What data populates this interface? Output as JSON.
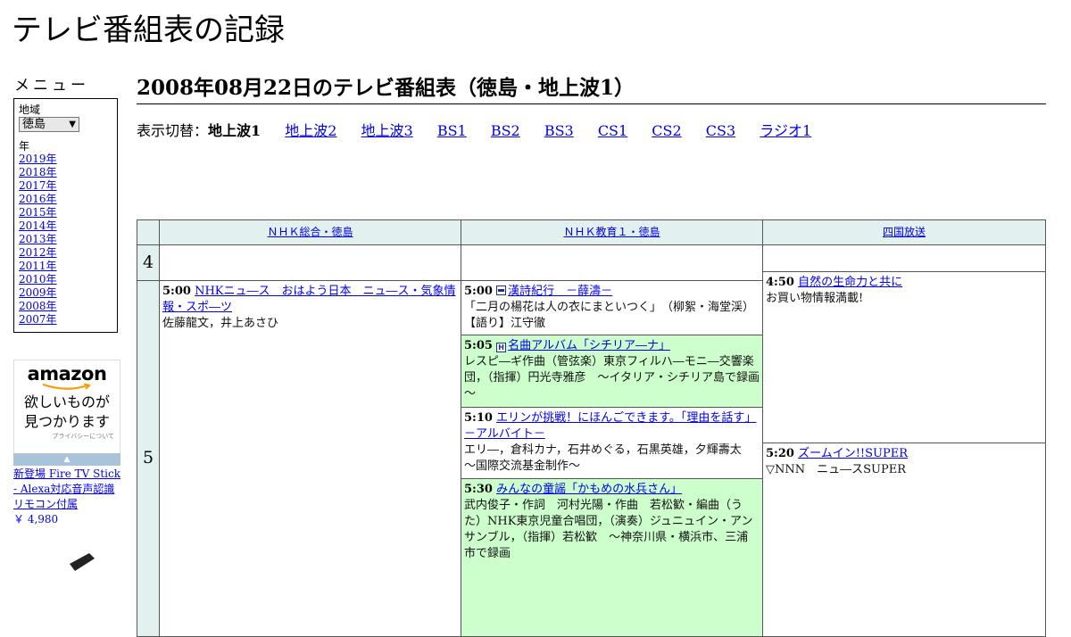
{
  "site_title": "テレビ番組表の記録",
  "sidebar": {
    "menu_heading": "メニュー",
    "region_label": "地域",
    "region_value": "徳島",
    "year_label": "年",
    "years": [
      "2019年",
      "2018年",
      "2017年",
      "2016年",
      "2015年",
      "2014年",
      "2013年",
      "2012年",
      "2011年",
      "2010年",
      "2009年",
      "2008年",
      "2007年"
    ]
  },
  "ad": {
    "logo": "amazon",
    "copy_line1": "欲しいものが",
    "copy_line2": "見つかります",
    "privacy": "プライバシーについて",
    "product": "新登場 Fire TV Stick - Alexa対応音声認識リモコン付属",
    "price": "￥ 4,980"
  },
  "page_title": "2008年08月22日のテレビ番組表（徳島・地上波1）",
  "switcher": {
    "label": "表示切替：",
    "current": "地上波1",
    "links": [
      "地上波2",
      "地上波3",
      "BS1",
      "BS2",
      "BS3",
      "CS1",
      "CS2",
      "CS3",
      "ラジオ1"
    ]
  },
  "channels": [
    "ＮＨＫ総合・徳島",
    "ＮＨＫ教育１・徳島",
    "四国放送"
  ],
  "hours": [
    "4",
    "5"
  ],
  "programs": {
    "nhk_g": [
      {
        "time": "5:00",
        "title": "NHKニュ―ス　おはよう日本　ニュ―ス・気象情報・スポ―ツ",
        "desc": "佐藤龍文，井上あさひ"
      }
    ],
    "nhk_e": [
      {
        "time": "5:00",
        "badge": "字",
        "title": "漢詩紀行　－薛濤－",
        "desc": "「二月の楊花は人の衣にまといつく」　（柳絮・海堂渓）　【語り】江守徹"
      },
      {
        "time": "5:05",
        "badge": "H",
        "title": "名曲アルバム「シチリア―ナ」",
        "desc": "レスピ―ギ作曲（管弦楽）東京フィルハ―モニ―交響楽団，（指揮）円光寺雅彦　～イタリア・シチリア島で録画～"
      },
      {
        "time": "5:10",
        "title": "エリンが挑戦！にほんごできます。「理由を話す」－アルバイト－",
        "desc": "エリ―，倉科カナ，石井めぐる，石黒英雄，夕輝壽太　～国際交流基金制作～"
      },
      {
        "time": "5:30",
        "title": "みんなの童謡「かもめの水兵さん」",
        "desc": "武内俊子・作詞　河村光陽・作曲　若松歓・編曲（うた）NHK東京児童合唱団，（演奏）ジュニュイン・アンサンブル，（指揮）若松歓　～神奈川県・横浜市、三浦市で録画"
      }
    ],
    "shikoku": [
      {
        "time": "4:50",
        "title": "自然の生命力と共に",
        "desc": "お買い物情報満載!"
      },
      {
        "time": "5:20",
        "title": "ズームイン!!SUPER",
        "desc": "▽NNN　ニュ―スSUPER"
      }
    ]
  },
  "colors": {
    "header_bg": "#e2f0ef",
    "highlight_bg": "#ccffcc",
    "link": "#0000ee"
  }
}
